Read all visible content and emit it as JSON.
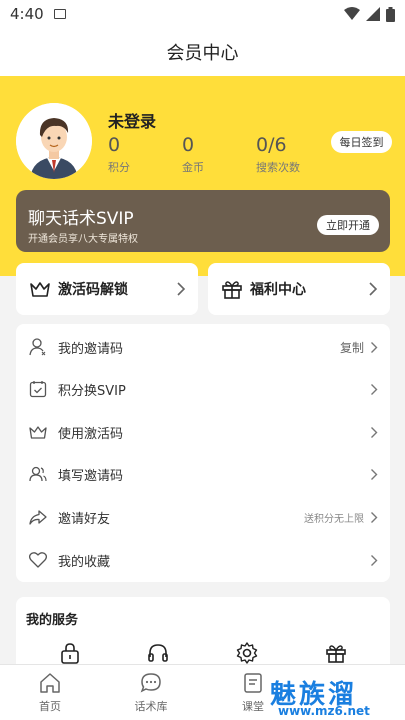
{
  "status_bar": {
    "time": "4:40"
  },
  "header": {
    "title": "会员中心"
  },
  "profile": {
    "username": "未登录",
    "stats": [
      {
        "value": "0",
        "label": "积分"
      },
      {
        "value": "0",
        "label": "金币"
      },
      {
        "value": "0/6",
        "label": "搜索次数"
      }
    ],
    "checkin_label": "每日签到"
  },
  "svip": {
    "title": "聊天话术SVIP",
    "subtitle": "开通会员享八大专属特权",
    "button_label": "立即开通"
  },
  "quick_actions": [
    {
      "label": "激活码解锁",
      "icon": "crown-icon"
    },
    {
      "label": "福利中心",
      "icon": "gift-icon"
    }
  ],
  "menu": [
    {
      "label": "我的邀请码",
      "right": "复制",
      "icon": "user-icon"
    },
    {
      "label": "积分换SVIP",
      "right": "",
      "icon": "calendar-icon"
    },
    {
      "label": "使用激活码",
      "right": "",
      "icon": "crown-icon"
    },
    {
      "label": "填写邀请码",
      "right": "",
      "icon": "users-icon"
    },
    {
      "label": "邀请好友",
      "right": "送积分无上限",
      "icon": "share-icon"
    },
    {
      "label": "我的收藏",
      "right": "",
      "icon": "heart-icon"
    }
  ],
  "services": {
    "title": "我的服务",
    "icons": [
      "lock-icon",
      "headset-icon",
      "gear-icon",
      "gift-icon"
    ]
  },
  "tabs": [
    {
      "label": "首页",
      "icon": "home-icon"
    },
    {
      "label": "话术库",
      "icon": "chat-icon"
    },
    {
      "label": "课堂",
      "icon": "book-icon"
    }
  ],
  "watermark": {
    "brand": "魅族溜",
    "url": "www.mz6.net"
  },
  "colors": {
    "accent_yellow": "#ffde3a",
    "svip_brown": "#6c5e4e",
    "watermark_blue": "#1a7fe0"
  }
}
